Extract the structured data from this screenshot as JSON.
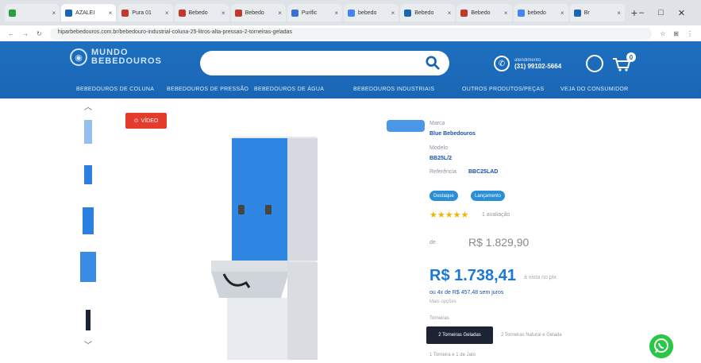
{
  "browser": {
    "tabs": [
      {
        "title": "",
        "color": "#2a9d3e"
      },
      {
        "title": "AZALEI",
        "color": "#1a66b5"
      },
      {
        "title": "Pura 01",
        "color": "#c0392b"
      },
      {
        "title": "Bebedo",
        "color": "#c0392b"
      },
      {
        "title": "Bebedo",
        "color": "#c0392b"
      },
      {
        "title": "Purific",
        "color": "#3b6fd6"
      },
      {
        "title": "bebedo",
        "color": "#4285f4"
      },
      {
        "title": "Bebedo",
        "color": "#1a66b5"
      },
      {
        "title": "Bebedo",
        "color": "#c0392b"
      },
      {
        "title": "bebedo",
        "color": "#4285f4"
      },
      {
        "title": "Br",
        "color": "#1a66b5"
      }
    ],
    "new_tab": "+",
    "url": "hiparbebedouros.com.br/bebedouro-industrial-coluna-25-litros-alta-pressao-2-torneiras-geladas"
  },
  "header": {
    "logo_line1": "MUNDO",
    "logo_line2": "BEBEDOUROS",
    "search_placeholder": "",
    "phone_label": "atendimento",
    "phone_number": "(31) 99102-5664",
    "cart_count": "0"
  },
  "nav": [
    "BEBEDOUROS DE COLUNA",
    "BEBEDOUROS DE PRESSÃO",
    "BEBEDOUROS DE ÁGUA",
    "BEBEDOUROS INDUSTRIAIS",
    "OUTROS PRODUTOS/PEÇAS",
    "VEJA DO CONSUMIDOR"
  ],
  "gallery": {
    "video_label": "VÍDEO"
  },
  "product": {
    "brand_label": "Marca",
    "brand": "Blue Bebedouros",
    "model_label": "Modelo",
    "model": "BB25L/2",
    "ref_label": "Referência",
    "ref": "BBC25LAD",
    "pills": [
      "Destaque",
      "Lançamento"
    ],
    "rating": 5,
    "reviews": "1 avaliação",
    "old_price_label": "de",
    "old_price": "R$ 1.829,90",
    "price": "R$ 1.738,41",
    "price_note": "à vista no pix",
    "installments": "ou 4x de R$ 457,48 sem juros",
    "installments_sub": "Mais opções",
    "option_label": "Torneiras",
    "option_active": "2 Torneiras Geladas",
    "option_2": "2 Torneiras Natural e Gelada",
    "option_3": "1 Torneira e 1 de Jato"
  },
  "colors": {
    "header_blue": "#1a66b5",
    "price_blue": "#1a78d8",
    "whatsapp": "#28c846",
    "video_red": "#e53b2c"
  }
}
